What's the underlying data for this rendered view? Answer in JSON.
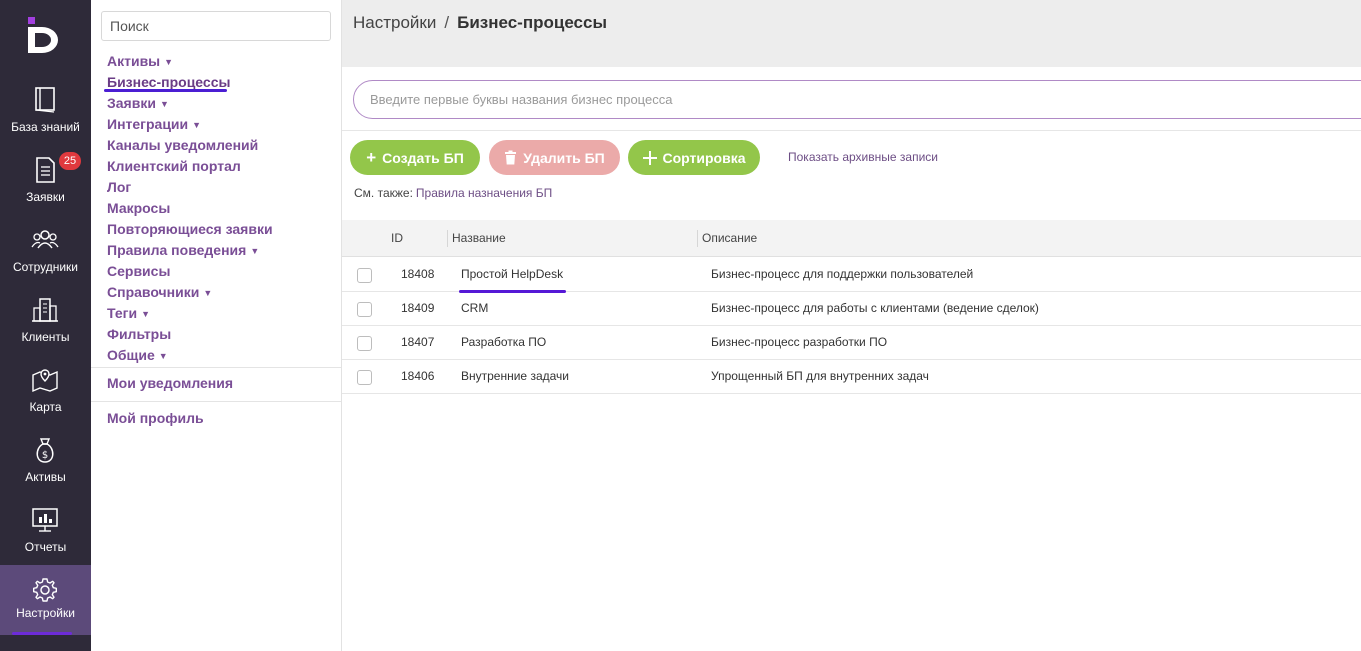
{
  "rail": {
    "items": [
      {
        "label": "База знаний",
        "icon": "book-icon"
      },
      {
        "label": "Заявки",
        "icon": "document-icon",
        "badge": "25"
      },
      {
        "label": "Сотрудники",
        "icon": "users-icon"
      },
      {
        "label": "Клиенты",
        "icon": "buildings-icon"
      },
      {
        "label": "Карта",
        "icon": "map-icon"
      },
      {
        "label": "Активы",
        "icon": "money-bag-icon"
      },
      {
        "label": "Отчеты",
        "icon": "monitor-chart-icon"
      },
      {
        "label": "Настройки",
        "icon": "gear-icon",
        "active": true
      }
    ],
    "accent": "#6d2bd9"
  },
  "nav": {
    "search_placeholder": "Поиск",
    "items": [
      {
        "label": "Активы",
        "caret": "▼"
      },
      {
        "label": "Бизнес-процессы",
        "caret": ""
      },
      {
        "label": "Заявки",
        "caret": "▼"
      },
      {
        "label": "Интеграции",
        "caret": "▼"
      },
      {
        "label": "Каналы уведомлений",
        "caret": ""
      },
      {
        "label": "Клиентский портал",
        "caret": ""
      },
      {
        "label": "Лог",
        "caret": ""
      },
      {
        "label": "Макросы",
        "caret": ""
      },
      {
        "label": "Повторяющиеся заявки",
        "caret": ""
      },
      {
        "label": "Правила поведения",
        "caret": "▼"
      },
      {
        "label": "Сервисы",
        "caret": ""
      },
      {
        "label": "Справочники",
        "caret": "▼"
      },
      {
        "label": "Теги",
        "caret": "▼"
      },
      {
        "label": "Фильтры",
        "caret": ""
      },
      {
        "label": "Общие",
        "caret": "▼"
      }
    ],
    "notifications": "Мои уведомления",
    "profile": "Мой профиль"
  },
  "breadcrumb": {
    "parent": "Настройки",
    "separator": "/",
    "current": "Бизнес-процессы"
  },
  "search": {
    "placeholder": "Введите первые буквы названия бизнес процесса"
  },
  "toolbar": {
    "create_label": "Создать БП",
    "delete_label": "Удалить БП",
    "sort_label": "Сортировка",
    "archive_label": "Показать архивные записи",
    "see_also_prefix": "См. также:",
    "see_also_link": "Правила назначения БП"
  },
  "table": {
    "columns": [
      "ID",
      "Название",
      "Описание"
    ],
    "rows": [
      {
        "id": "18408",
        "name": "Простой HelpDesk",
        "desc": "Бизнес-процесс для поддержки пользователей"
      },
      {
        "id": "18409",
        "name": "CRM",
        "desc": "Бизнес-процесс для работы с клиентами (ведение сделок)"
      },
      {
        "id": "18407",
        "name": "Разработка ПО",
        "desc": "Бизнес-процесс разработки ПО"
      },
      {
        "id": "18406",
        "name": "Внутренние задачи",
        "desc": "Упрощенный БП для внутренних задач"
      }
    ]
  },
  "colors": {
    "rail_bg": "#2e2a39",
    "link": "#7a4e96",
    "green": "#93c64a",
    "pink": "#ebaaa9",
    "highlight": "#5518d6"
  }
}
